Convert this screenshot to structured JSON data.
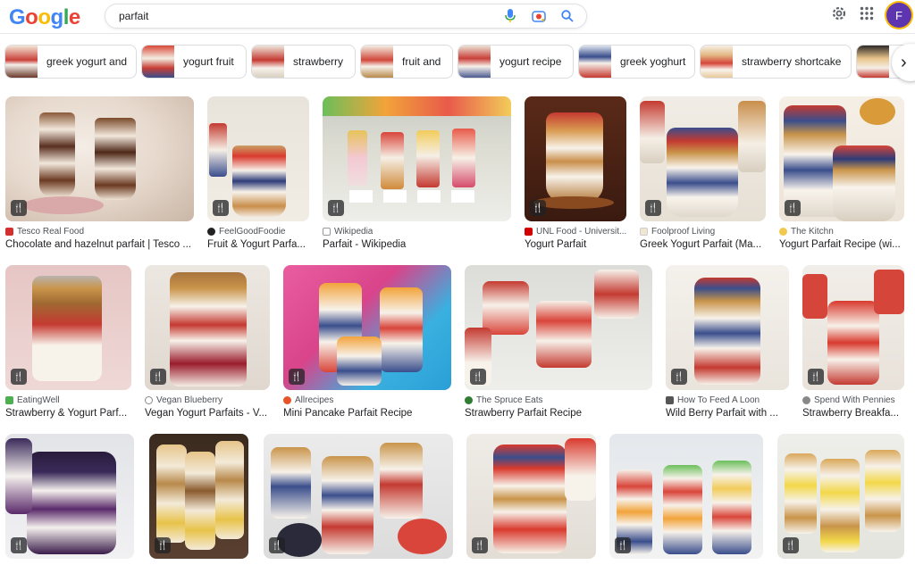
{
  "search": {
    "query": "parfait"
  },
  "header": {
    "logo": "Google",
    "avatar_letter": "F"
  },
  "chips": [
    {
      "label": "greek yogurt and"
    },
    {
      "label": "yogurt fruit"
    },
    {
      "label": "strawberry"
    },
    {
      "label": "fruit and"
    },
    {
      "label": "yogurt recipe"
    },
    {
      "label": "greek yoghurt"
    },
    {
      "label": "strawberry shortcake"
    }
  ],
  "results": [
    {
      "source": "Tesco Real Food",
      "title": "Chocolate and hazelnut parfait | Tesco ..."
    },
    {
      "source": "FeelGoodFoodie",
      "title": "Fruit & Yogurt Parfa..."
    },
    {
      "source": "Wikipedia",
      "title": "Parfait - Wikipedia"
    },
    {
      "source": "UNL Food - Universit...",
      "title": "Yogurt Parfait"
    },
    {
      "source": "Foolproof Living",
      "title": "Greek Yogurt Parfait (Ma..."
    },
    {
      "source": "The Kitchn",
      "title": "Yogurt Parfait Recipe (wi..."
    },
    {
      "source": "EatingWell",
      "title": "Strawberry & Yogurt Parf..."
    },
    {
      "source": "Vegan Blueberry",
      "title": "Vegan Yogurt Parfaits - V..."
    },
    {
      "source": "Allrecipes",
      "title": "Mini Pancake Parfait Recipe"
    },
    {
      "source": "The Spruce Eats",
      "title": "Strawberry Parfait Recipe"
    },
    {
      "source": "How To Feed A Loon",
      "title": "Wild Berry Parfait with ..."
    },
    {
      "source": "Spend With Pennies",
      "title": "Strawberry Breakfa..."
    },
    {
      "source": "",
      "title": ""
    },
    {
      "source": "",
      "title": ""
    },
    {
      "source": "",
      "title": ""
    },
    {
      "source": "",
      "title": ""
    },
    {
      "source": "",
      "title": ""
    },
    {
      "source": "",
      "title": ""
    }
  ],
  "badge_glyph": "🍴",
  "colors": {
    "blue": "#4285f4",
    "red": "#ea4335",
    "yellow": "#fbbc05",
    "green": "#34a853"
  }
}
